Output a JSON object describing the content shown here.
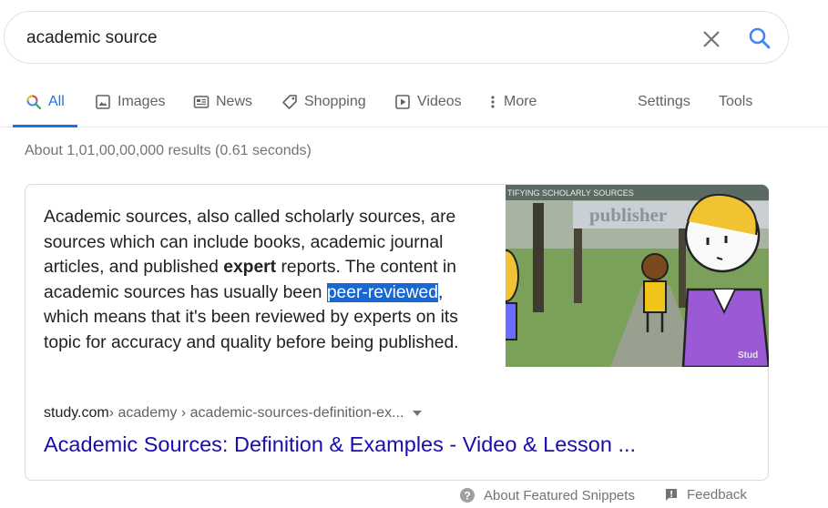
{
  "search": {
    "query": "academic source"
  },
  "tabs": [
    {
      "label": "All",
      "active": true
    },
    {
      "label": "Images"
    },
    {
      "label": "News"
    },
    {
      "label": "Shopping"
    },
    {
      "label": "Videos"
    },
    {
      "label": "More"
    }
  ],
  "tools": {
    "settings": "Settings",
    "tools": "Tools"
  },
  "stats": "About 1,01,00,00,000 results (0.61 seconds)",
  "snippet": {
    "text_before_bold": "Academic sources, also called scholarly sources, are sources which can include books, academic journal articles, and published ",
    "bold": "expert",
    "text_after_bold": " reports. The content in academic sources has usually been ",
    "highlight": "peer-reviewed",
    "text_end": ", which means that it's been reviewed by experts on its topic for accuracy and quality before being published.",
    "image": {
      "banner": "TIFYING SCHOLARLY SOURCES",
      "board_word": "publisher",
      "watermark": "Stud"
    },
    "breadcrumb": {
      "domain": "study.com",
      "path": " › academy › academic-sources-definition-ex..."
    },
    "title": "Academic Sources: Definition & Examples - Video & Lesson ..."
  },
  "footer": {
    "about": "About Featured Snippets",
    "feedback": "Feedback"
  },
  "colors": {
    "link": "#1a0dab",
    "accent": "#1a73e8",
    "highlight": "#1967d2"
  }
}
